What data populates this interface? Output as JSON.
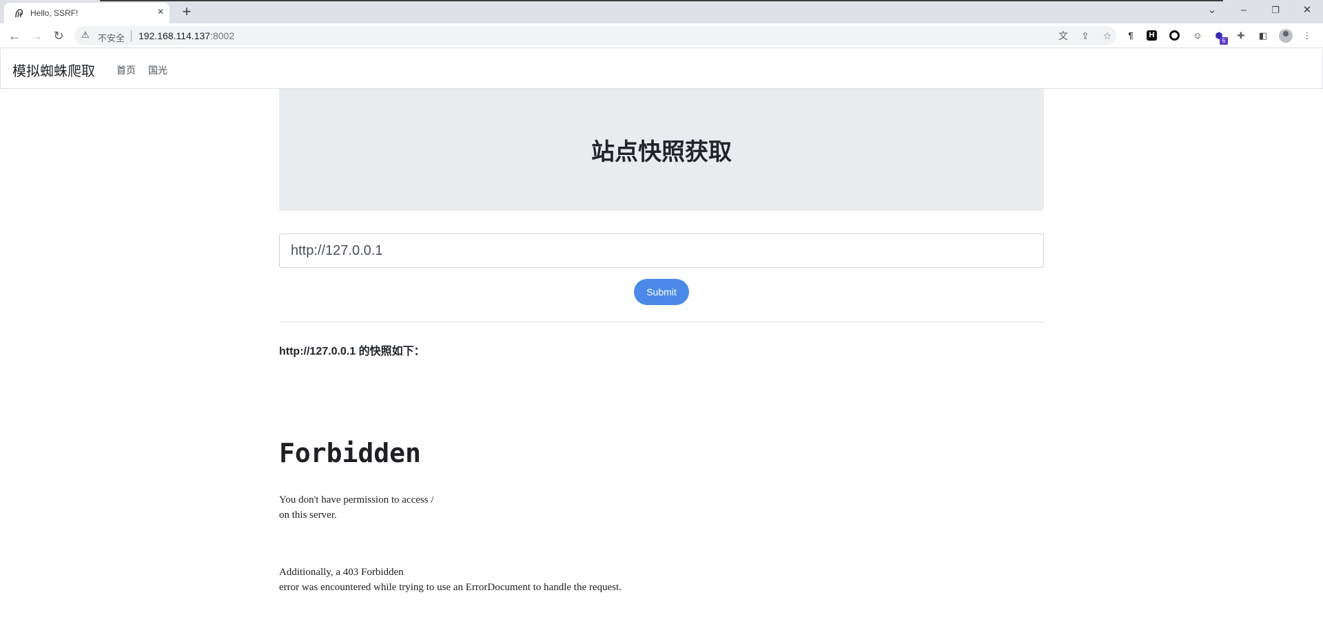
{
  "browser": {
    "tab_title": "Hello, SSRF!",
    "tab_close": "×",
    "new_tab": "+",
    "not_secure_label": "不安全",
    "url_host": "192.168.114.137",
    "url_port": ":8002",
    "extension_badge": "6",
    "window_controls": {
      "dropdown": "⌄",
      "minimize": "–",
      "restore": "❐",
      "close": "✕"
    }
  },
  "navbar": {
    "brand": "模拟蜘蛛爬取",
    "links": [
      "首页",
      "国光"
    ]
  },
  "jumbotron": {
    "title": "站点快照获取"
  },
  "form": {
    "url_value": "http://127.0.0.1",
    "submit_label": "Submit"
  },
  "result": {
    "snapshot_label": "http://127.0.0.1 的快照如下：",
    "heading": "Forbidden",
    "line1": "You don't have permission to access /",
    "line2": "on this server.",
    "line3": "Additionally, a 403 Forbidden",
    "line4": "error was encountered while trying to use an ErrorDocument to handle the request."
  },
  "colors": {
    "accent": "#4a89e8",
    "jumbotron_bg": "#e9ecef",
    "badge": "#5b3cc4"
  }
}
